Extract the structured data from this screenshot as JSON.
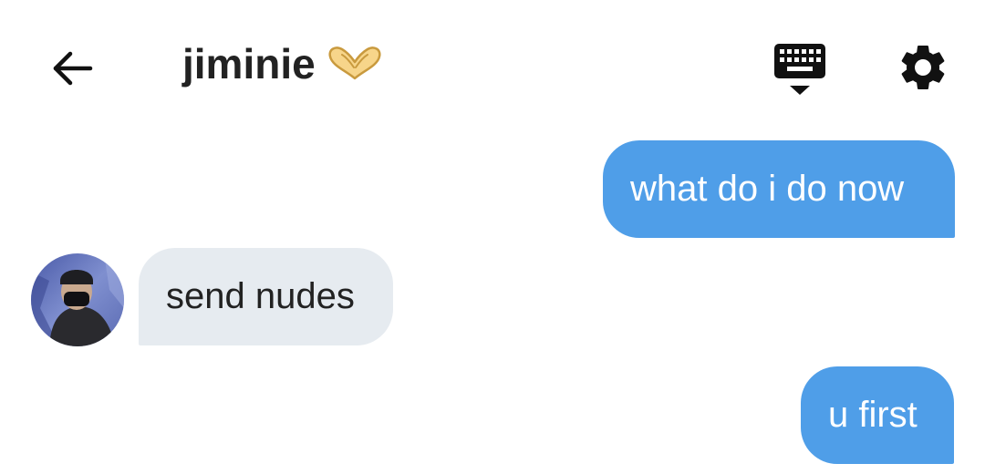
{
  "header": {
    "title": "jiminie",
    "title_emoji": "heart-hands-emoji",
    "back_icon": "arrow-left-icon",
    "keyboard_icon": "keyboard-hide-icon",
    "settings_icon": "gear-icon"
  },
  "messages": [
    {
      "direction": "outgoing",
      "text": "what do i do now"
    },
    {
      "direction": "incoming",
      "text": "send nudes"
    },
    {
      "direction": "outgoing",
      "text": "u first"
    }
  ],
  "colors": {
    "outgoing_bubble": "#4f9ee8",
    "incoming_bubble": "#e6ebf0",
    "text_dark": "#222222",
    "text_light": "#ffffff"
  }
}
